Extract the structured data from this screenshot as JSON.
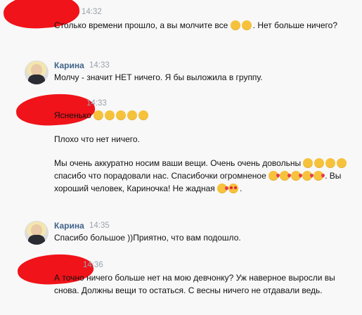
{
  "messages": [
    {
      "sender": "",
      "time": "14:32",
      "paragraphs": [
        [
          "Столько времени прошло, а вы молчите все ",
          "{relieved}",
          "{confounded}",
          ". Нет больше ничего?"
        ]
      ]
    },
    {
      "sender": "Карина",
      "time": "14:33",
      "paragraphs": [
        [
          "Молчу - значит НЕТ ничего. Я бы выложила в группу."
        ]
      ]
    },
    {
      "sender": "",
      "time": "14:33",
      "paragraphs": [
        [
          "Ясненько ",
          "{relieved}",
          "{relieved}",
          "{relieved}",
          "{relieved}",
          "{relieved}"
        ],
        [
          "Плохо что нет ничего."
        ],
        [
          "Мы очень аккуратно носим ваши вещи. Очень очень довольны ",
          "{blush}",
          "{blush}",
          "{blush}",
          "{blush}",
          "спасибо что порадовали нас. Спасибочки огромненое ",
          "{kiss}",
          "{kiss}",
          "{kiss}",
          "{kiss}",
          "{kiss}",
          ". Вы хороший человек, Кариночка! Не жадная ",
          "{kiss}",
          "{love}",
          "."
        ]
      ]
    },
    {
      "sender": "Карина",
      "time": "14:35",
      "paragraphs": [
        [
          "Спасибо большое ))Приятно, что вам подошло."
        ]
      ]
    },
    {
      "sender": "",
      "time": "14:36",
      "paragraphs": [
        [
          "А точно ничего больше нет на мою девчонку? Уж наверное выросли вы снова. Должны вещи то остаться. С весны ничего не отдавали ведь."
        ]
      ]
    }
  ],
  "icons": {
    "relieved": "relieved-face-emoji",
    "confounded": "confounded-face-emoji",
    "blush": "smiling-face-emoji",
    "kiss": "face-blowing-kiss-emoji",
    "love": "heart-eyes-face-emoji"
  },
  "colors": {
    "background": "#f8f8f8",
    "name": "#42648b",
    "time": "#9aa3ad",
    "redaction": "#f0131a",
    "emoji": "#f6c23b"
  }
}
